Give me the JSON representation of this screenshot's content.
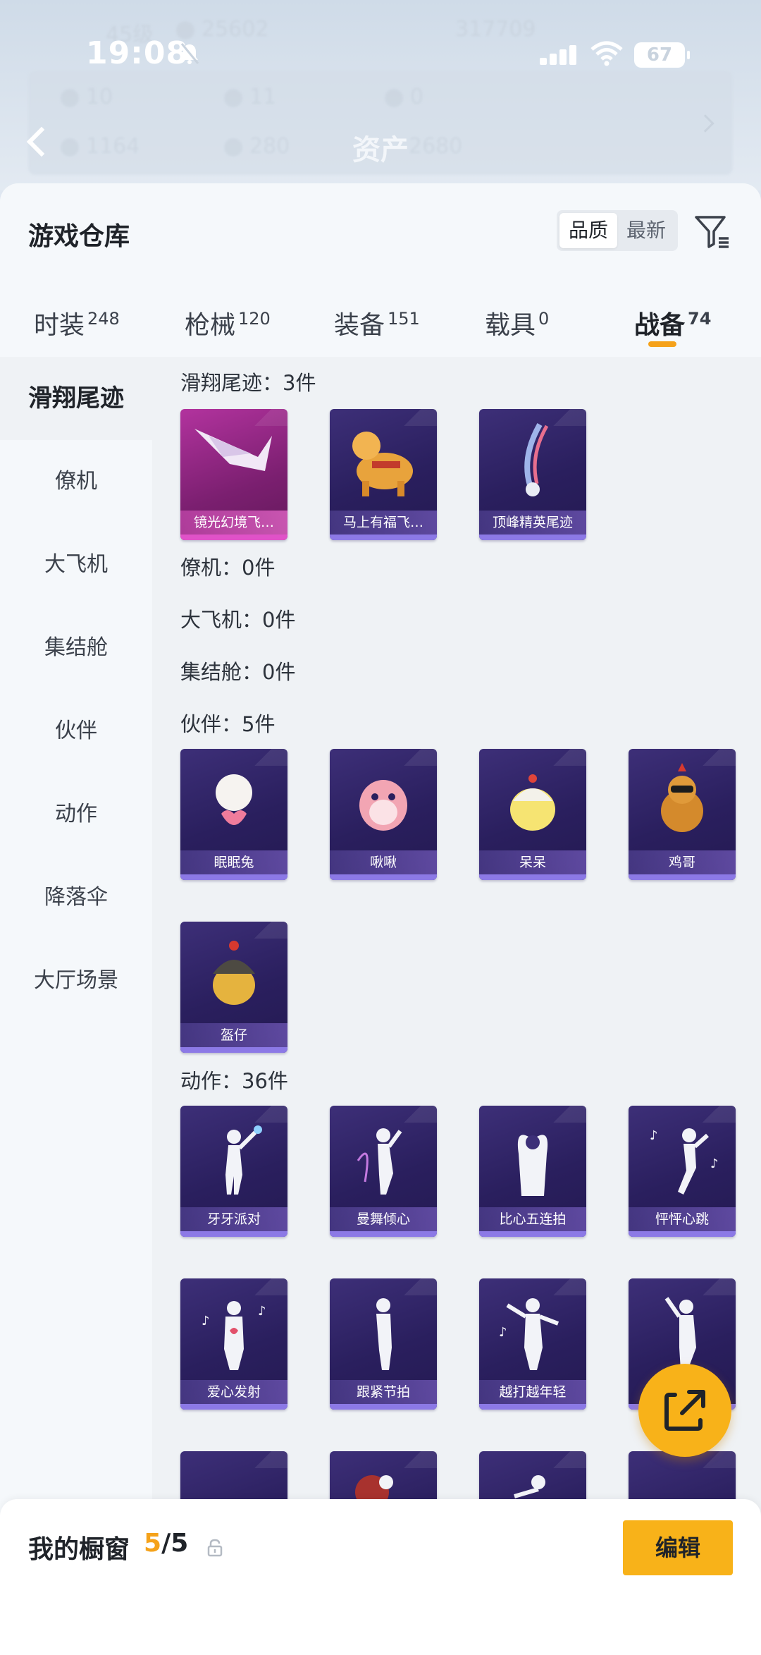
{
  "status_bar": {
    "time": "19:08",
    "battery": "67"
  },
  "background_header": {
    "title": "资产",
    "stats": [
      "45级",
      "25602",
      "317709",
      "10",
      "11",
      "0",
      "1164",
      "280",
      "2680"
    ]
  },
  "sheet": {
    "title": "游戏仓库",
    "sort": {
      "options": [
        "品质",
        "最新"
      ],
      "active": "品质"
    }
  },
  "tabs": [
    {
      "label": "时装",
      "count": "248"
    },
    {
      "label": "枪械",
      "count": "120"
    },
    {
      "label": "装备",
      "count": "151"
    },
    {
      "label": "载具",
      "count": "0"
    },
    {
      "label": "战备",
      "count": "74",
      "active": true
    }
  ],
  "sidebar": {
    "items": [
      {
        "label": "滑翔尾迹",
        "active": true
      },
      {
        "label": "僚机"
      },
      {
        "label": "大飞机"
      },
      {
        "label": "集结舱"
      },
      {
        "label": "伙伴"
      },
      {
        "label": "动作"
      },
      {
        "label": "降落伞"
      },
      {
        "label": "大厅场景"
      }
    ]
  },
  "sections": [
    {
      "label": "滑翔尾迹：3件",
      "items": [
        "镜光幻境飞…",
        "马上有福飞…",
        "顶峰精英尾迹"
      ]
    },
    {
      "label": "僚机：0件",
      "items": []
    },
    {
      "label": "大飞机：0件",
      "items": []
    },
    {
      "label": "集结舱：0件",
      "items": []
    },
    {
      "label": "伙伴：5件",
      "items": [
        "眠眠兔",
        "啾啾",
        "呆呆",
        "鸡哥",
        "盔仔"
      ]
    },
    {
      "label": "动作：36件",
      "items": [
        "牙牙派对",
        "曼舞倾心",
        "比心五连拍",
        "怦怦心跳",
        "爱心发射",
        "跟紧节拍",
        "越打越年轻"
      ]
    }
  ],
  "showcase": {
    "title": "我的橱窗",
    "current": "5",
    "total": "/5",
    "edit_label": "编辑"
  },
  "icons": {
    "back": "chevron-left-icon",
    "filter": "filter-icon",
    "fab": "share-external-icon",
    "lock": "lock-icon"
  },
  "colors": {
    "accent": "#f5a21a",
    "card_purple": "#2a1f5e",
    "card_pink": "#b2339e"
  }
}
